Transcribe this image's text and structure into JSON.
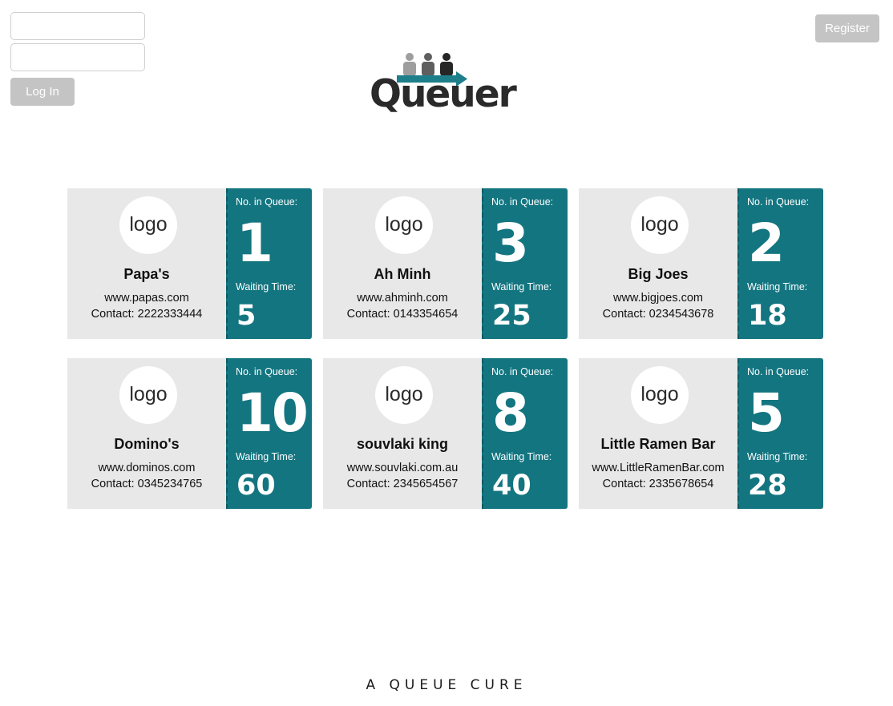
{
  "auth": {
    "username_value": "",
    "password_value": "",
    "login_label": "Log In",
    "register_label": "Register"
  },
  "brand": {
    "name": "Queuer",
    "tagline": "A QUEUE CURE",
    "icon": "people-queue-arrow-icon",
    "colors": {
      "person_light": "#9e9e9e",
      "person_mid": "#5f5f5f",
      "person_dark": "#262626",
      "arrow": "#1d7f8a"
    }
  },
  "labels": {
    "queue": "No. in Queue:",
    "wait": "Waiting Time:"
  },
  "colors": {
    "ticket": "#137580",
    "card": "#e8e8e8",
    "button": "#c4c4c4"
  },
  "businesses": [
    {
      "logo": "logo",
      "name": "Papa's",
      "website": "www.papas.com",
      "contact": "Contact: 2222333444",
      "queue": "1",
      "wait": "5"
    },
    {
      "logo": "logo",
      "name": "Ah Minh",
      "website": "www.ahminh.com",
      "contact": "Contact: 0143354654",
      "queue": "3",
      "wait": "25"
    },
    {
      "logo": "logo",
      "name": "Big Joes",
      "website": "www.bigjoes.com",
      "contact": "Contact: 0234543678",
      "queue": "2",
      "wait": "18"
    },
    {
      "logo": "logo",
      "name": "Domino's",
      "website": "www.dominos.com",
      "contact": "Contact: 0345234765",
      "queue": "10",
      "wait": "60"
    },
    {
      "logo": "logo",
      "name": "souvlaki king",
      "website": "www.souvlaki.com.au",
      "contact": "Contact: 2345654567",
      "queue": "8",
      "wait": "40"
    },
    {
      "logo": "logo",
      "name": "Little Ramen Bar",
      "website": "www.LittleRamenBar.com",
      "contact": "Contact: 2335678654",
      "queue": "5",
      "wait": "28"
    }
  ]
}
